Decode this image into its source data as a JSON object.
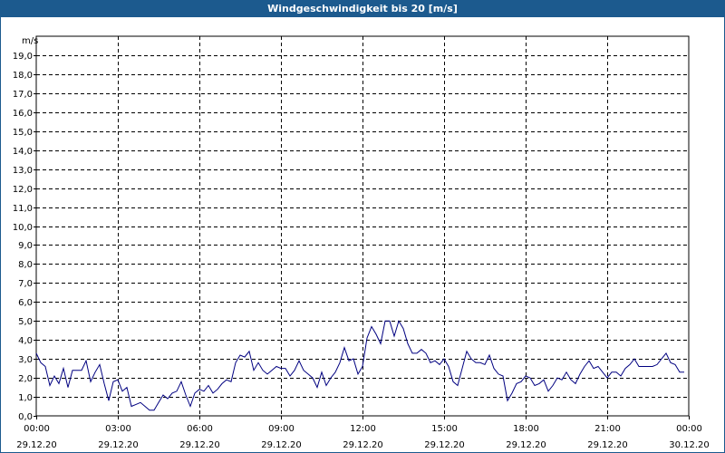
{
  "window": {
    "title": "Windgeschwindigkeit bis 20 [m/s]"
  },
  "chart_data": {
    "type": "line",
    "title": "Windgeschwindigkeit bis 20 [m/s]",
    "ylabel": "m/s",
    "xlabel": "",
    "ylim": [
      0,
      20
    ],
    "xlim": [
      "29.12.20 00:00",
      "30.12.20 00:00"
    ],
    "grid": true,
    "y_ticks": [
      "0,0",
      "1,0",
      "2,0",
      "3,0",
      "4,0",
      "5,0",
      "6,0",
      "7,0",
      "8,0",
      "9,0",
      "10,0",
      "11,0",
      "12,0",
      "13,0",
      "14,0",
      "15,0",
      "16,0",
      "17,0",
      "18,0",
      "19,0"
    ],
    "x_ticks": [
      {
        "time": "00:00",
        "date": "29.12.20"
      },
      {
        "time": "03:00",
        "date": "29.12.20"
      },
      {
        "time": "06:00",
        "date": "29.12.20"
      },
      {
        "time": "09:00",
        "date": "29.12.20"
      },
      {
        "time": "12:00",
        "date": "29.12.20"
      },
      {
        "time": "15:00",
        "date": "29.12.20"
      },
      {
        "time": "18:00",
        "date": "29.12.20"
      },
      {
        "time": "21:00",
        "date": "29.12.20"
      },
      {
        "time": "00:00",
        "date": "30.12.20"
      }
    ],
    "series": [
      {
        "color": "#000080",
        "points": [
          [
            "00:00",
            3.3
          ],
          [
            "00:10",
            2.8
          ],
          [
            "00:20",
            2.6
          ],
          [
            "00:30",
            1.6
          ],
          [
            "00:40",
            2.1
          ],
          [
            "00:50",
            1.7
          ],
          [
            "01:00",
            2.5
          ],
          [
            "01:10",
            1.5
          ],
          [
            "01:20",
            2.4
          ],
          [
            "01:30",
            2.4
          ],
          [
            "01:40",
            2.4
          ],
          [
            "01:50",
            2.9
          ],
          [
            "02:00",
            1.8
          ],
          [
            "02:10",
            2.3
          ],
          [
            "02:20",
            2.7
          ],
          [
            "02:30",
            1.7
          ],
          [
            "02:40",
            0.8
          ],
          [
            "02:50",
            1.8
          ],
          [
            "03:00",
            1.9
          ],
          [
            "03:10",
            1.3
          ],
          [
            "03:20",
            1.5
          ],
          [
            "03:30",
            0.5
          ],
          [
            "03:40",
            0.6
          ],
          [
            "03:50",
            0.7
          ],
          [
            "04:00",
            0.5
          ],
          [
            "04:10",
            0.3
          ],
          [
            "04:20",
            0.3
          ],
          [
            "04:30",
            0.7
          ],
          [
            "04:40",
            1.1
          ],
          [
            "04:50",
            0.9
          ],
          [
            "05:00",
            1.2
          ],
          [
            "05:10",
            1.3
          ],
          [
            "05:20",
            1.8
          ],
          [
            "05:30",
            1.1
          ],
          [
            "05:40",
            0.5
          ],
          [
            "05:50",
            1.2
          ],
          [
            "06:00",
            1.4
          ],
          [
            "06:10",
            1.3
          ],
          [
            "06:20",
            1.6
          ],
          [
            "06:30",
            1.2
          ],
          [
            "06:40",
            1.4
          ],
          [
            "06:50",
            1.7
          ],
          [
            "07:00",
            1.9
          ],
          [
            "07:10",
            1.8
          ],
          [
            "07:20",
            2.8
          ],
          [
            "07:30",
            3.2
          ],
          [
            "07:40",
            3.1
          ],
          [
            "07:50",
            3.4
          ],
          [
            "08:00",
            2.4
          ],
          [
            "08:10",
            2.8
          ],
          [
            "08:20",
            2.4
          ],
          [
            "08:30",
            2.2
          ],
          [
            "08:40",
            2.4
          ],
          [
            "08:50",
            2.6
          ],
          [
            "09:00",
            2.5
          ],
          [
            "09:10",
            2.5
          ],
          [
            "09:20",
            2.1
          ],
          [
            "09:30",
            2.4
          ],
          [
            "09:40",
            2.9
          ],
          [
            "09:50",
            2.4
          ],
          [
            "10:00",
            2.2
          ],
          [
            "10:10",
            2.0
          ],
          [
            "10:20",
            1.5
          ],
          [
            "10:30",
            2.3
          ],
          [
            "10:40",
            1.6
          ],
          [
            "10:50",
            2.0
          ],
          [
            "11:00",
            2.3
          ],
          [
            "11:10",
            2.8
          ],
          [
            "11:20",
            3.6
          ],
          [
            "11:30",
            2.9
          ],
          [
            "11:40",
            3.0
          ],
          [
            "11:50",
            2.2
          ],
          [
            "12:00",
            2.6
          ],
          [
            "12:10",
            4.1
          ],
          [
            "12:20",
            4.7
          ],
          [
            "12:30",
            4.3
          ],
          [
            "12:40",
            3.8
          ],
          [
            "12:50",
            5.0
          ],
          [
            "13:00",
            5.0
          ],
          [
            "13:10",
            4.2
          ],
          [
            "13:20",
            5.0
          ],
          [
            "13:30",
            4.6
          ],
          [
            "13:40",
            3.8
          ],
          [
            "13:50",
            3.3
          ],
          [
            "14:00",
            3.3
          ],
          [
            "14:10",
            3.5
          ],
          [
            "14:20",
            3.3
          ],
          [
            "14:30",
            2.8
          ],
          [
            "14:40",
            2.9
          ],
          [
            "14:50",
            2.7
          ],
          [
            "15:00",
            3.0
          ],
          [
            "15:10",
            2.6
          ],
          [
            "15:20",
            1.8
          ],
          [
            "15:30",
            1.6
          ],
          [
            "15:40",
            2.5
          ],
          [
            "15:50",
            3.4
          ],
          [
            "16:00",
            3.0
          ],
          [
            "16:10",
            2.8
          ],
          [
            "16:20",
            2.8
          ],
          [
            "16:30",
            2.7
          ],
          [
            "16:40",
            3.2
          ],
          [
            "16:50",
            2.5
          ],
          [
            "17:00",
            2.2
          ],
          [
            "17:10",
            2.1
          ],
          [
            "17:20",
            0.8
          ],
          [
            "17:30",
            1.2
          ],
          [
            "17:40",
            1.7
          ],
          [
            "17:50",
            1.8
          ],
          [
            "18:00",
            2.1
          ],
          [
            "18:10",
            2.0
          ],
          [
            "18:20",
            1.6
          ],
          [
            "18:30",
            1.7
          ],
          [
            "18:40",
            1.9
          ],
          [
            "18:50",
            1.3
          ],
          [
            "19:00",
            1.6
          ],
          [
            "19:10",
            2.0
          ],
          [
            "19:20",
            1.9
          ],
          [
            "19:30",
            2.3
          ],
          [
            "19:40",
            1.9
          ],
          [
            "19:50",
            1.7
          ],
          [
            "20:00",
            2.2
          ],
          [
            "20:10",
            2.6
          ],
          [
            "20:20",
            2.9
          ],
          [
            "20:30",
            2.5
          ],
          [
            "20:40",
            2.6
          ],
          [
            "20:50",
            2.3
          ],
          [
            "21:00",
            2.0
          ],
          [
            "21:10",
            2.3
          ],
          [
            "21:20",
            2.3
          ],
          [
            "21:30",
            2.1
          ],
          [
            "21:40",
            2.5
          ],
          [
            "21:50",
            2.7
          ],
          [
            "22:00",
            3.0
          ],
          [
            "22:10",
            2.6
          ],
          [
            "22:20",
            2.6
          ],
          [
            "22:30",
            2.6
          ],
          [
            "22:40",
            2.6
          ],
          [
            "22:50",
            2.7
          ],
          [
            "23:00",
            3.0
          ],
          [
            "23:10",
            3.3
          ],
          [
            "23:20",
            2.8
          ],
          [
            "23:30",
            2.7
          ],
          [
            "23:40",
            2.3
          ],
          [
            "23:50",
            2.3
          ]
        ]
      }
    ]
  }
}
